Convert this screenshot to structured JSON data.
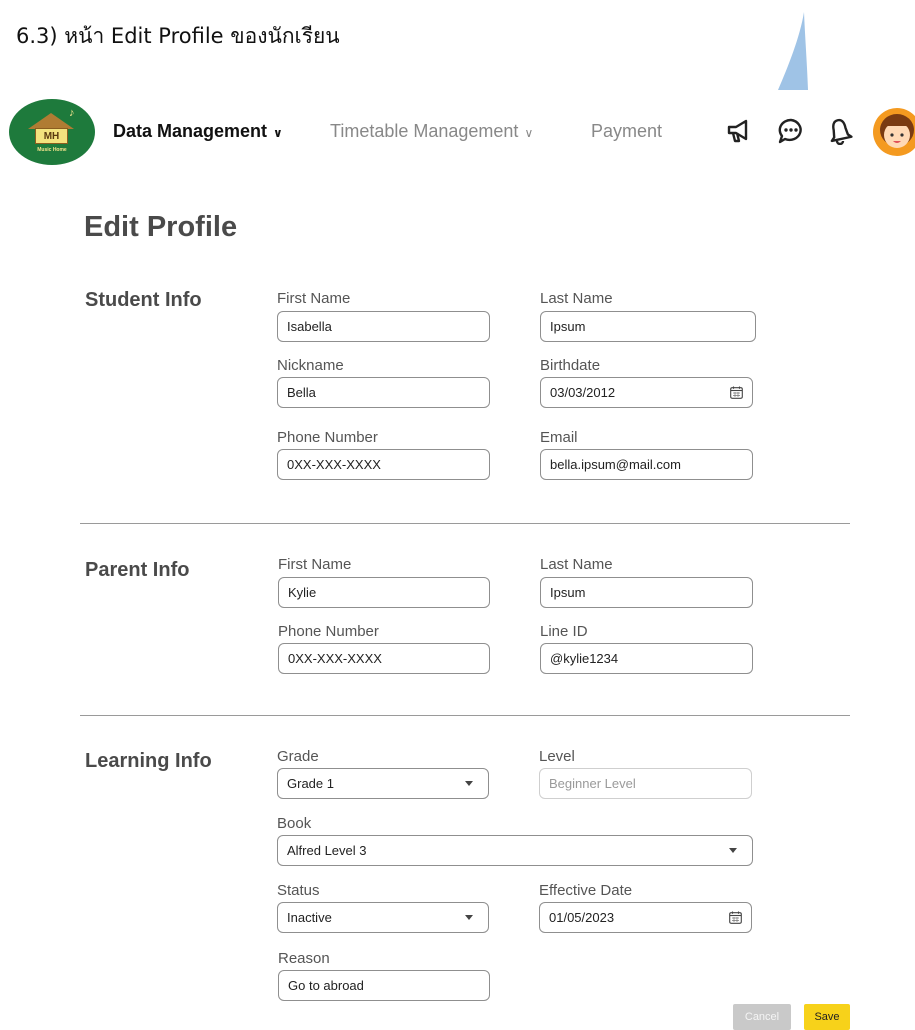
{
  "document": {
    "heading": "6.3) หน้า Edit Profile ของนักเรียน"
  },
  "logo": {
    "initials": "MH",
    "tagline": "Music Home"
  },
  "nav": {
    "data_management": "Data Management",
    "timetable_management": "Timetable Management",
    "payment": "Payment"
  },
  "header_icons": [
    "megaphone-icon",
    "chat-icon",
    "bell-icon",
    "avatar"
  ],
  "page": {
    "title": "Edit Profile"
  },
  "student": {
    "title": "Student Info",
    "first_name_label": "First Name",
    "first_name": "Isabella",
    "last_name_label": "Last Name",
    "last_name": "Ipsum",
    "nickname_label": "Nickname",
    "nickname": "Bella",
    "birthdate_label": "Birthdate",
    "birthdate": "03/03/2012",
    "phone_label": "Phone Number",
    "phone": "0XX-XXX-XXXX",
    "email_label": "Email",
    "email": "bella.ipsum@mail.com"
  },
  "parent": {
    "title": "Parent Info",
    "first_name_label": "First Name",
    "first_name": "Kylie",
    "last_name_label": "Last Name",
    "last_name": "Ipsum",
    "phone_label": "Phone Number",
    "phone": "0XX-XXX-XXXX",
    "line_label": "Line ID",
    "line_id": "@kylie1234"
  },
  "learning": {
    "title": "Learning Info",
    "grade_label": "Grade",
    "grade": "Grade 1",
    "level_label": "Level",
    "level_placeholder": "Beginner Level",
    "book_label": "Book",
    "book": "Alfred Level 3",
    "status_label": "Status",
    "status": "Inactive",
    "effective_date_label": "Effective Date",
    "effective_date": "01/05/2023",
    "reason_label": "Reason",
    "reason": "Go to abroad"
  },
  "actions": {
    "cancel": "Cancel",
    "save": "Save"
  },
  "colors": {
    "save": "#f7d21a",
    "cancel": "#c9c9c9",
    "logo_bg": "#1e7a3c",
    "avatar_bg": "#f49a20"
  }
}
